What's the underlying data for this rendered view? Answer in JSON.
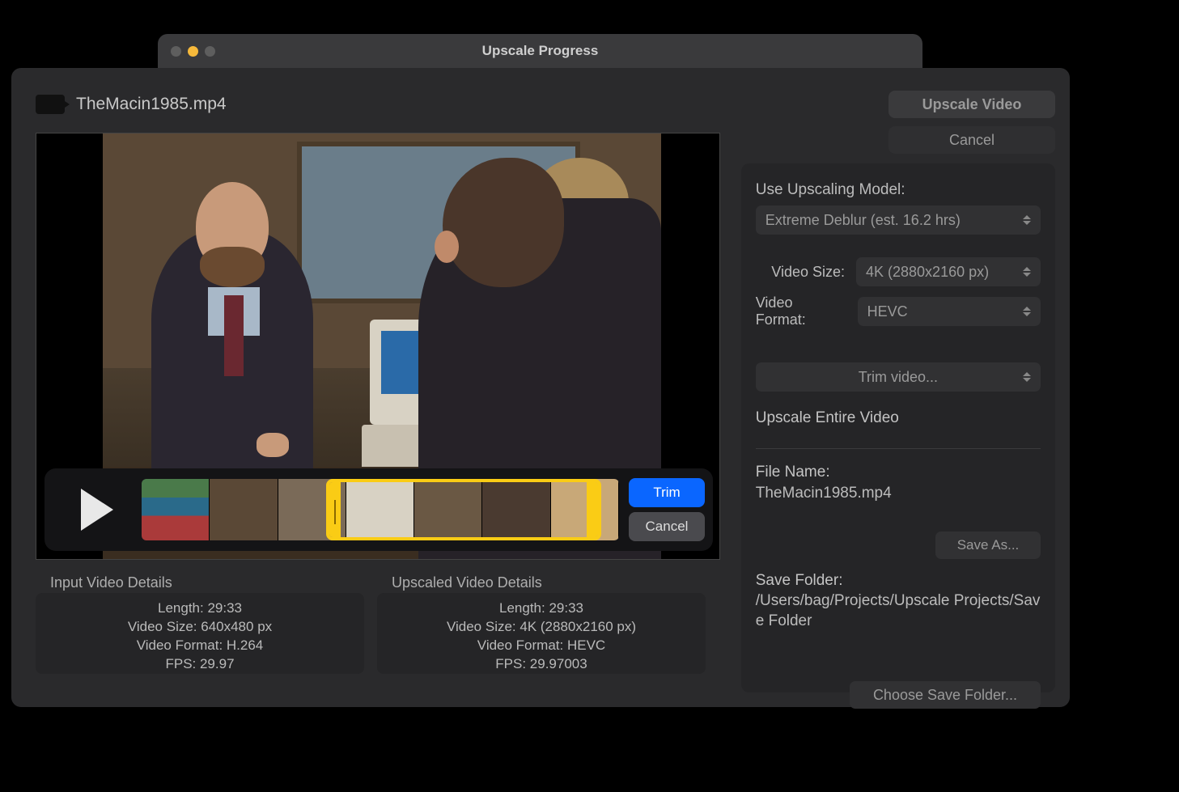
{
  "modal": {
    "title": "Upscale Progress"
  },
  "file": {
    "name": "TheMacin1985.mp4"
  },
  "actions": {
    "upscale": "Upscale Video",
    "cancel": "Cancel",
    "trim": "Trim",
    "trim_cancel": "Cancel",
    "trim_video": "Trim video...",
    "save_as": "Save As...",
    "choose_folder": "Choose Save Folder..."
  },
  "settings": {
    "model_label": "Use Upscaling Model:",
    "model_value": "Extreme Deblur (est. 16.2 hrs)",
    "video_size_label": "Video Size:",
    "video_size_value": "4K (2880x2160 px)",
    "video_format_label": "Video Format:",
    "video_format_value": "HEVC",
    "scope": "Upscale Entire Video",
    "filename_label": "File Name:",
    "filename_value": "TheMacin1985.mp4",
    "folder_label": "Save Folder:",
    "folder_value": "/Users/bag/Projects/Upscale Projects/Save Folder"
  },
  "input_details": {
    "title": "Input Video Details",
    "length": "Length: 29:33",
    "size": "Video Size: 640x480 px",
    "format": "Video Format: H.264",
    "fps": "FPS: 29.97"
  },
  "output_details": {
    "title": "Upscaled Video Details",
    "length": "Length: 29:33",
    "size": "Video Size: 4K (2880x2160 px)",
    "format": "Video Format: HEVC",
    "fps": "FPS: 29.97003"
  }
}
